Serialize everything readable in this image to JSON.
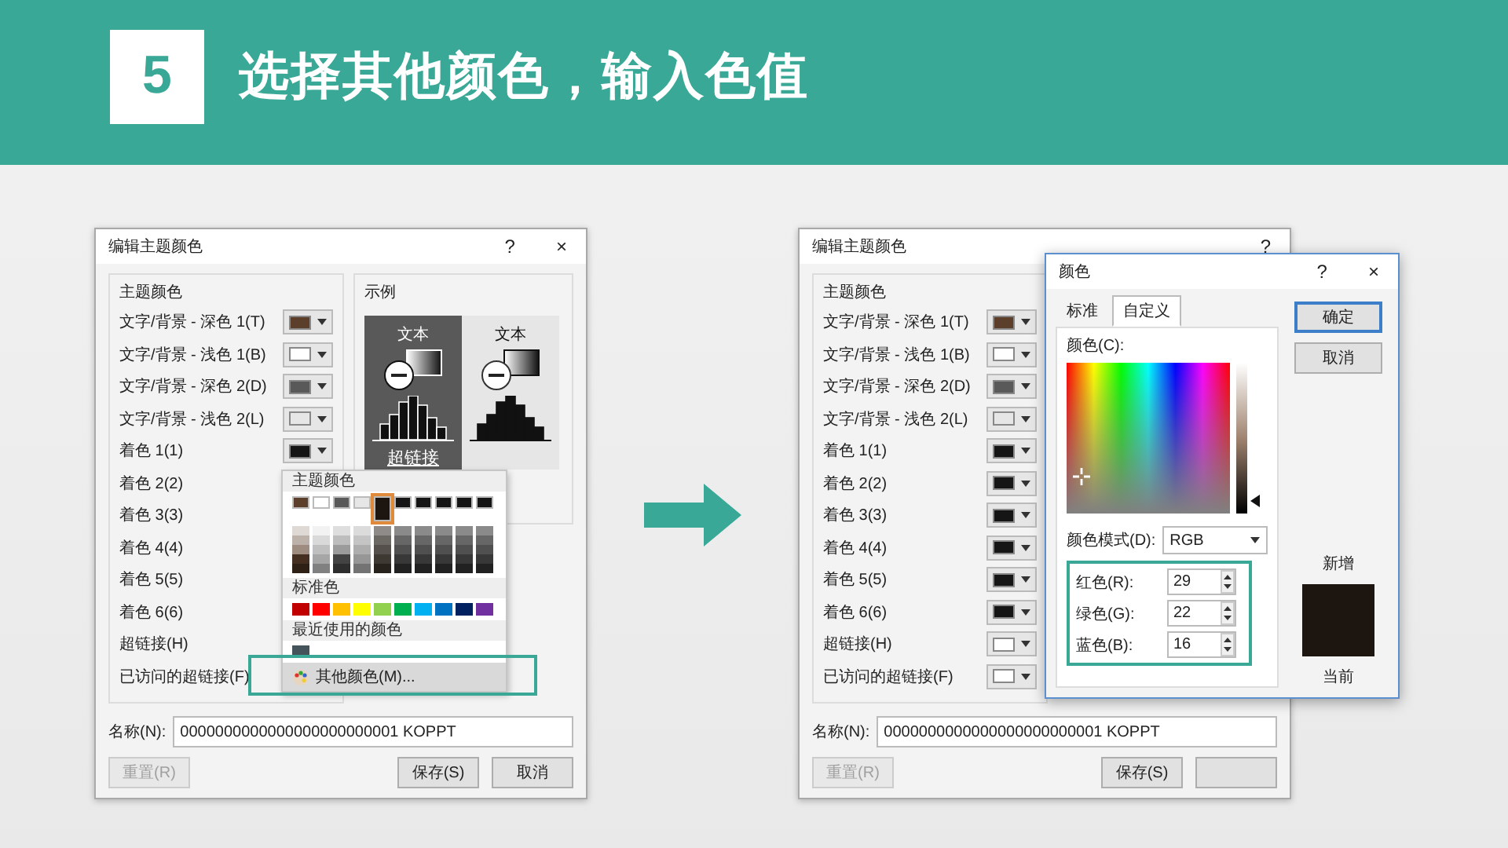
{
  "header": {
    "step": "5",
    "title": "选择其他颜色，输入色值"
  },
  "dialogs": [
    {
      "title": "编辑主题颜色",
      "help": "?",
      "close": "×",
      "group_title": "主题颜色",
      "rows": [
        {
          "label": "文字/背景 - 深色 1(T)",
          "color": "#5b3f2a"
        },
        {
          "label": "文字/背景 - 浅色 1(B)",
          "color": "#ffffff"
        },
        {
          "label": "文字/背景 - 深色 2(D)",
          "color": "#595959"
        },
        {
          "label": "文字/背景 - 浅色 2(L)",
          "color": "#e7e6e6"
        },
        {
          "label": "着色 1(1)",
          "color": "#151515"
        },
        {
          "label": "着色 2(2)"
        },
        {
          "label": "着色 3(3)"
        },
        {
          "label": "着色 4(4)"
        },
        {
          "label": "着色 5(5)"
        },
        {
          "label": "着色 6(6)"
        },
        {
          "label": "超链接(H)"
        },
        {
          "label": "已访问的超链接(F)"
        }
      ],
      "sample": {
        "title": "示例",
        "panels": [
          {
            "kind": "dark",
            "text": "文本",
            "link": "超链接"
          },
          {
            "kind": "light",
            "text": "文本"
          }
        ]
      },
      "name_label": "名称(N):",
      "name_value": "0000000000000000000000001 KOPPT",
      "reset_button": {
        "label": "重置(R)",
        "disabled": true
      },
      "buttons": [
        "保存(S)",
        "取消"
      ],
      "popup": {
        "title": "主题颜色",
        "theme_colors": [
          {
            "color": "#5b3f2a",
            "selected": false
          },
          {
            "color": "#ffffff",
            "selected": false
          },
          {
            "color": "#595959",
            "selected": false
          },
          {
            "color": "#e7e6e6",
            "selected": false
          },
          {
            "color": "#1d1610",
            "selected": true
          },
          {
            "color": "#151515",
            "selected": false
          },
          {
            "color": "#151515",
            "selected": false
          },
          {
            "color": "#151515",
            "selected": false
          },
          {
            "color": "#151515",
            "selected": false
          },
          {
            "color": "#151515",
            "selected": false
          }
        ],
        "standard_title": "标准色",
        "standard_colors": [
          {
            "color": "#c00000"
          },
          {
            "color": "#ff0000"
          },
          {
            "color": "#ffc000"
          },
          {
            "color": "#ffff00"
          },
          {
            "color": "#92d050"
          },
          {
            "color": "#00b050"
          },
          {
            "color": "#00b0f0"
          },
          {
            "color": "#0070c0"
          },
          {
            "color": "#002060"
          },
          {
            "color": "#7030a0"
          }
        ],
        "recent_title": "最近使用的颜色",
        "recent_colors": [
          {
            "color": "#44545a"
          }
        ],
        "more_item": {
          "label": "其他颜色(M)...",
          "highlighted": true
        }
      }
    },
    {
      "title": "编辑主题颜色",
      "help": "?",
      "group_title": "主题颜色",
      "rows": [
        {
          "label": "文字/背景 - 深色 1(T)",
          "color": "#5b3f2a"
        },
        {
          "label": "文字/背景 - 浅色 1(B)",
          "color": "#ffffff"
        },
        {
          "label": "文字/背景 - 深色 2(D)",
          "color": "#595959"
        },
        {
          "label": "文字/背景 - 浅色 2(L)",
          "color": "#e7e6e6"
        },
        {
          "label": "着色 1(1)",
          "color": "#151515"
        },
        {
          "label": "着色 2(2)",
          "color": "#151515"
        },
        {
          "label": "着色 3(3)",
          "color": "#151515"
        },
        {
          "label": "着色 4(4)",
          "color": "#151515"
        },
        {
          "label": "着色 5(5)",
          "color": "#151515"
        },
        {
          "label": "着色 6(6)",
          "color": "#151515"
        },
        {
          "label": "超链接(H)",
          "color": "#ffffff"
        },
        {
          "label": "已访问的超链接(F)",
          "color": "#ffffff"
        }
      ],
      "name_label": "名称(N):",
      "name_value": "0000000000000000000000001 KOPPT",
      "reset_button": {
        "label": "重置(R)",
        "disabled": true
      },
      "buttons": [
        "保存(S)"
      ],
      "color_dialog": {
        "title": "颜色",
        "help": "?",
        "close": "×",
        "tabs": [
          {
            "label": "标准",
            "selected": false
          },
          {
            "label": "自定义",
            "selected": true
          }
        ],
        "buttons": [
          {
            "label": "确定",
            "default": true
          },
          {
            "label": "取消",
            "default": false
          }
        ],
        "picker_label": "颜色(C):",
        "luminance": {
          "level": 0.08
        },
        "mode_label": "颜色模式(D):",
        "mode_value": "RGB",
        "channels": [
          {
            "label": "红色(R):",
            "value": "29"
          },
          {
            "label": "绿色(G):",
            "value": "22"
          },
          {
            "label": "蓝色(B):",
            "value": "16"
          }
        ],
        "channels_highlighted": true,
        "new_label": "新增",
        "current_label": "当前"
      }
    }
  ]
}
